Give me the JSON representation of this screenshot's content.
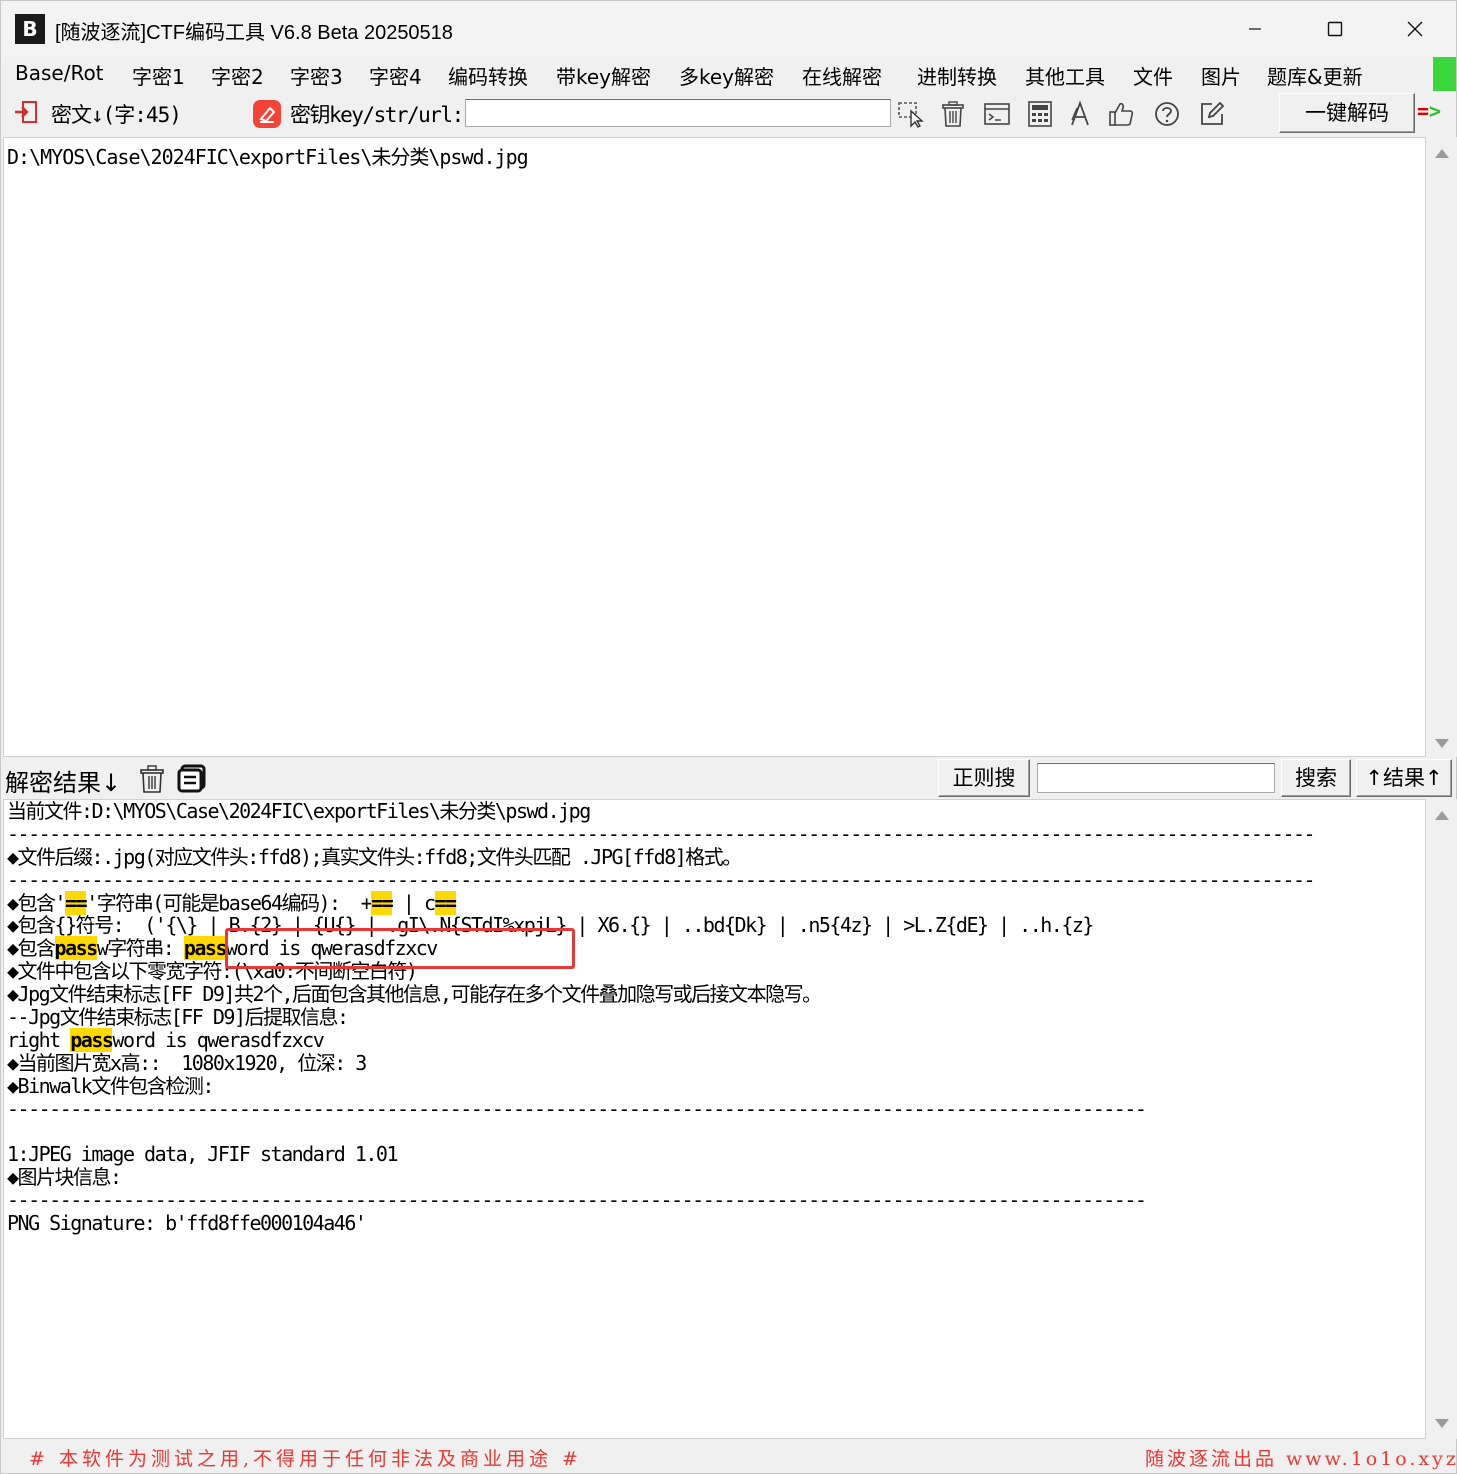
{
  "window": {
    "title": "[随波逐流]CTF编码工具 V6.8 Beta 20250518",
    "icon_text": "B"
  },
  "menu": {
    "items": [
      "Base/Rot",
      "字密1",
      "字密2",
      "字密3",
      "字密4",
      "编码转换",
      "带key解密",
      "多key解密",
      "在线解密",
      "进制转换",
      "其他工具",
      "文件",
      "图片",
      "题库&更新"
    ]
  },
  "toolbar": {
    "cipher_label": "密文↓(字:45)",
    "key_label": "密钥key/str/url:",
    "key_value": "",
    "icons": [
      "cursor-select-icon",
      "trash-icon",
      "terminal-icon",
      "calculator-icon",
      "font-a-icon",
      "thumbs-up-icon",
      "help-icon",
      "edit-icon"
    ],
    "onekey_label": "一键解码",
    "go_arrow": "=",
    "go_arrow2": ">"
  },
  "cipher": {
    "text": "D:\\MYOS\\Case\\2024FIC\\exportFiles\\未分类\\pswd.jpg"
  },
  "result_bar": {
    "label": "解密结果↓",
    "regex_label": "正则搜",
    "search_value": "",
    "search_label": "搜索",
    "result_up_label": "↑结果↑"
  },
  "result": {
    "current_file": "当前文件:D:\\MYOS\\Case\\2024FIC\\exportFiles\\未分类\\pswd.jpg",
    "sep_long": "----------------------------------------------------------------------------------------------------------------------------",
    "suffix_line": "◆文件后缀:.jpg(对应文件头:ffd8);真实文件头:ffd8;文件头匹配 .JPG[ffd8]格式。",
    "base64_prefix": "◆包含'",
    "base64_hl": "==",
    "base64_mid": "'字符串(可能是base64编码):  +",
    "base64_hl2": "==",
    "base64_mid2": " | c",
    "base64_hl3": "==",
    "braces_line": "◆包含{}符号:  ('{\\} | B.{2} | {U{} | .gI\\.N{STdI%xpjL} | X6.{} | ..bd{Dk} | .n5{4z} | >L.Z{dE} | ..h.{z}",
    "pass_prefix": "◆包含",
    "pass_hl": "pass",
    "pass_mid": "w字符串: ",
    "pass_hl2": "pass",
    "pass_tail": "word is qwerasdfzxcv",
    "zero_width_line": "◆文件中包含以下零宽字符:(\\xa0:不间断空白符)",
    "jpg_end_line": "◆Jpg文件结束标志[FF D9]共2个,后面包含其他信息,可能存在多个文件叠加隐写或后接文本隐写。",
    "jpg_extract_line": "--Jpg文件结束标志[FF D9]后提取信息:",
    "right_prefix": "right ",
    "right_hl": "pass",
    "right_tail": "word is qwerasdfzxcv",
    "size_line": "◆当前图片宽x高::  1080x1920, 位深: 3",
    "binwalk_line": "◆Binwalk文件包含检测:",
    "sep_mid": "------------------------------------------------------------------------------------------------------------",
    "blank": "",
    "jpeg_line": "1:JPEG image data, JFIF standard 1.01",
    "block_line": "◆图片块信息:",
    "png_line": "PNG Signature: b'ffd8ffe000104a46'"
  },
  "status": {
    "left": "# 本软件为测试之用,不得用于任何非法及商业用途 #",
    "right": "随波逐流出品 www.1o1o.xyz"
  },
  "colors": {
    "highlight": "#ffd800",
    "annotation_box": "#e53935",
    "status_text": "#e53935",
    "accent_green": "#3bd63b"
  }
}
